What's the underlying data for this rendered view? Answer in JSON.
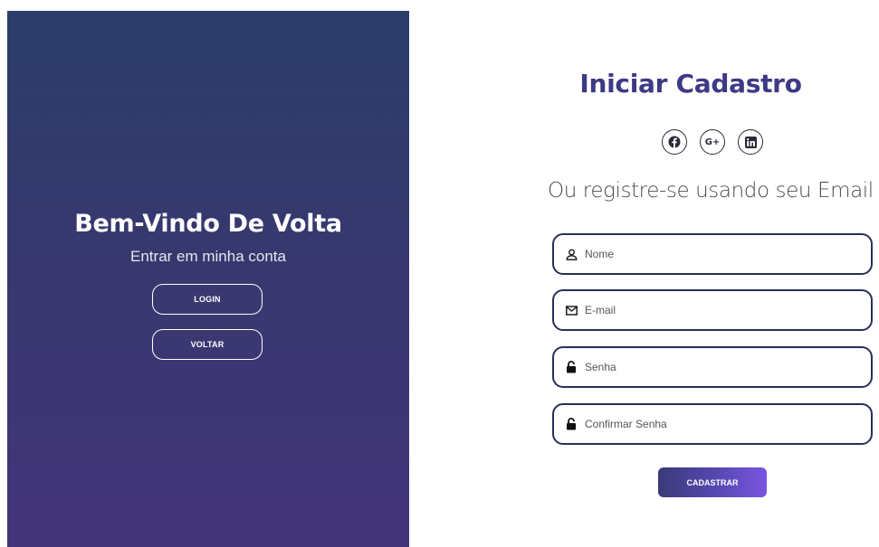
{
  "left": {
    "title": "Bem-Vindo De Volta",
    "subtitle": "Entrar em minha conta",
    "login_label": "LOGIN",
    "back_label": "VOLTAR"
  },
  "right": {
    "title": "Iniciar Cadastro",
    "social": [
      "facebook-icon",
      "google-plus-icon",
      "linkedin-icon"
    ],
    "google_plus_text": "G+",
    "alt_text": "Ou registre-se usando seu Email",
    "fields": [
      {
        "icon": "user-icon",
        "placeholder": "Nome"
      },
      {
        "icon": "envelope-icon",
        "placeholder": "E-mail"
      },
      {
        "icon": "lock-icon",
        "placeholder": "Senha"
      },
      {
        "icon": "lock-icon",
        "placeholder": "Confirmar Senha"
      }
    ],
    "submit_label": "CADASTRAR"
  },
  "colors": {
    "panel_top": "#2c3d69",
    "panel_bottom": "#43347a",
    "title": "#3d3a85",
    "field_border": "#27305a",
    "button_accent": "#7a55e0"
  }
}
